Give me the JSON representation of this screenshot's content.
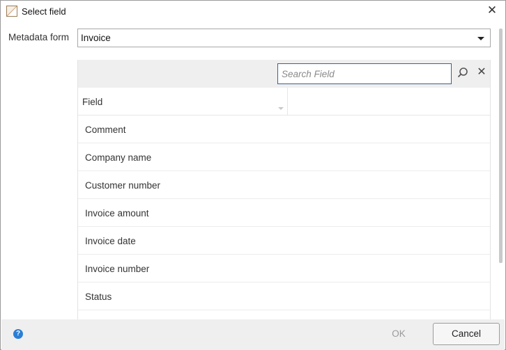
{
  "window": {
    "title": "Select field",
    "icon": "app-form-icon",
    "close_icon": "close-icon"
  },
  "form": {
    "label": "Metadata form",
    "selected_value": "Invoice"
  },
  "search": {
    "placeholder": "Search Field",
    "value": ""
  },
  "table": {
    "column_header": "Field",
    "rows": [
      "Comment",
      "Company name",
      "Customer number",
      "Invoice amount",
      "Invoice date",
      "Invoice number",
      "Status"
    ]
  },
  "footer": {
    "help_icon": "help-icon",
    "ok_label": "OK",
    "cancel_label": "Cancel"
  },
  "colors": {
    "accent": "#2a7fd4",
    "search_border": "#3d5f8e",
    "toolbar_bg": "#efefef"
  }
}
